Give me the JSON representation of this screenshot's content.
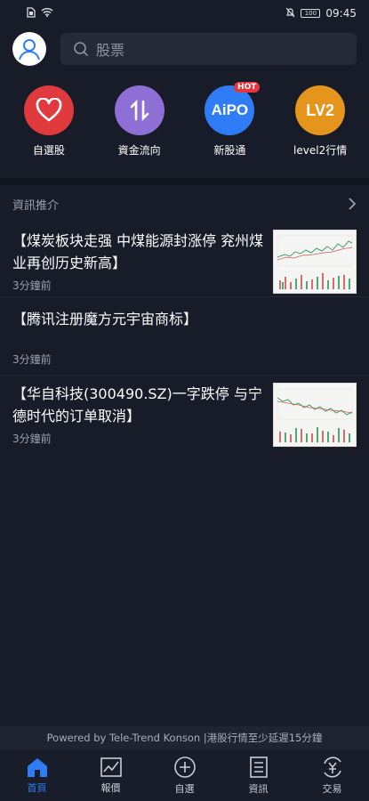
{
  "status_bar": {
    "time": "09:45",
    "battery": "100"
  },
  "header": {
    "search_placeholder": "股票"
  },
  "quick_links": [
    {
      "label": "自選股",
      "icon": "heart-icon",
      "color": "#e0393e"
    },
    {
      "label": "資金流向",
      "icon": "flow-arrows-icon",
      "color": "#8d6fd6"
    },
    {
      "label": "新股通",
      "icon": "aipo-icon",
      "color": "#2f7df6",
      "badge": "HOT",
      "icon_text": "AiPO"
    },
    {
      "label": "level2行情",
      "icon": "lv2-icon",
      "color": "#e6951c",
      "icon_text": "LV2"
    }
  ],
  "section": {
    "title": "資訊推介"
  },
  "news": [
    {
      "title": "【煤炭板块走强 中煤能源封涨停 兖州煤业再创历史新高】",
      "time": "3分鐘前",
      "has_thumb": true
    },
    {
      "title": "【腾讯注册魔方元宇宙商标】",
      "time": "3分鐘前",
      "has_thumb": false
    },
    {
      "title": "【华自科技(300490.SZ)一字跌停 与宁德时代的订单取消】",
      "time": "3分鐘前",
      "has_thumb": true
    }
  ],
  "footer": {
    "powered": "Powered by Tele-Trend Konson |港股行情至少延遲15分鐘"
  },
  "tabs": [
    {
      "label": "首頁",
      "icon": "home-icon",
      "active": true
    },
    {
      "label": "報價",
      "icon": "chart-icon",
      "active": false
    },
    {
      "label": "自選",
      "icon": "plus-circle-icon",
      "active": false
    },
    {
      "label": "資訊",
      "icon": "document-icon",
      "active": false
    },
    {
      "label": "交易",
      "icon": "exchange-icon",
      "active": false
    }
  ]
}
